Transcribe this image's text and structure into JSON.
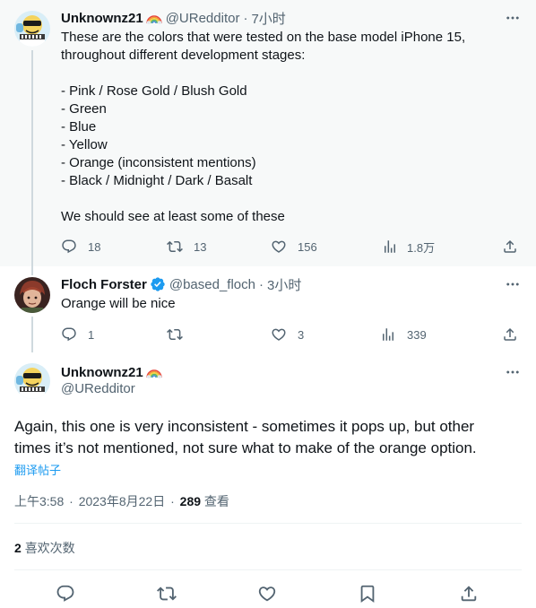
{
  "tweets": [
    {
      "name": "Unknownz21",
      "handle": "@URedditor",
      "time": "7小时",
      "lines": [
        "These are the colors that were tested on the base model iPhone 15,",
        "throughout different development stages:",
        "",
        "- Pink / Rose Gold / Blush Gold",
        "- Green",
        "- Blue",
        "- Yellow",
        "- Orange (inconsistent mentions)",
        "- Black / Midnight / Dark / Basalt",
        "",
        "We should see at least some of these"
      ],
      "stats": {
        "replies": "18",
        "retweets": "13",
        "likes": "156",
        "views": "1.8万"
      }
    },
    {
      "name": "Floch Forster",
      "handle": "@based_floch",
      "time": "3小时",
      "lines": [
        "Orange will be nice"
      ],
      "stats": {
        "replies": "1",
        "retweets": "",
        "likes": "3",
        "views": "339"
      }
    }
  ],
  "main_tweet": {
    "name": "Unknownz21",
    "handle": "@URedditor",
    "lines": [
      "Again, this one is very inconsistent - sometimes it pops up, but other",
      "times it’s not mentioned, not sure what to make of the orange option."
    ],
    "translate_label": "翻译帖子",
    "time": "上午3:58",
    "date": "2023年8月22日",
    "views": "289",
    "views_label": "查看",
    "separator": "·",
    "likes_count": "2",
    "likes_label": "喜欢次数"
  },
  "icons": {
    "more": "more-horizontal-icon",
    "reply": "reply-icon",
    "retweet": "retweet-icon",
    "like": "heart-icon",
    "views": "views-chart-icon",
    "share": "share-icon",
    "bookmark": "bookmark-icon",
    "verified": "verified-badge-icon",
    "rainbow": "rainbow-emoji-icon"
  },
  "colors": {
    "text": "#0f1419",
    "muted": "#536471",
    "link": "#1d9bf0",
    "highlight_bg": "#f7f9f9",
    "verified": "#1d9bf0",
    "thread_line": "#cfd9de"
  }
}
